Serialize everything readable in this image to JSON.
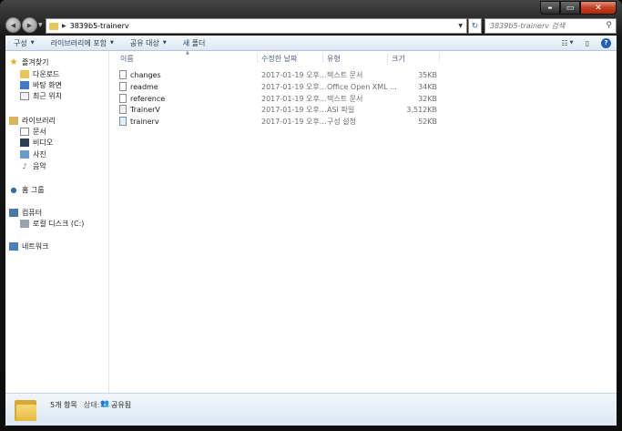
{
  "window": {
    "caption": {
      "minimize": "▬",
      "maximize": "▭",
      "close": "✕"
    }
  },
  "nav": {
    "back": "◀",
    "forward": "▶",
    "path": "3839b5-trainerv",
    "search_placeholder": "3839b5-trainerv 검색"
  },
  "toolbar": {
    "organize": "구성",
    "include_library": "라이브러리에 포함",
    "share_with": "공유 대상",
    "new_folder": "새 폴더"
  },
  "sidebar": {
    "favorites": "즐겨찾기",
    "downloads": "다운로드",
    "desktop": "바탕 화면",
    "recent": "최근 위치",
    "libraries": "라이브러리",
    "documents": "문서",
    "videos": "비디오",
    "pictures": "사진",
    "music": "음악",
    "homegroup": "홈 그룹",
    "computer": "컴퓨터",
    "local_disk": "로컬 디스크 (C:)",
    "network": "네트워크"
  },
  "columns": {
    "name": "이름",
    "date": "수정한 날짜",
    "type": "유형",
    "size": "크기"
  },
  "files": [
    {
      "name": "changes",
      "date": "2017-01-19 오후...",
      "type": "텍스트 문서",
      "size": "35KB",
      "icon": "text-file-icon"
    },
    {
      "name": "readme",
      "date": "2017-01-19 오후...",
      "type": "Office Open XML ...",
      "size": "34KB",
      "icon": "text-file-icon"
    },
    {
      "name": "reference",
      "date": "2017-01-19 오후...",
      "type": "텍스트 문서",
      "size": "32KB",
      "icon": "text-file-icon"
    },
    {
      "name": "TrainerV",
      "date": "2017-01-19 오후...",
      "type": "ASI 파일",
      "size": "3,512KB",
      "icon": "asi-file-icon"
    },
    {
      "name": "trainerv",
      "date": "2017-01-19 오후...",
      "type": "구성 설정",
      "size": "52KB",
      "icon": "config-file-icon"
    }
  ],
  "details": {
    "count": "5개 항목",
    "state_label": "상태:",
    "state": "공유됨"
  }
}
